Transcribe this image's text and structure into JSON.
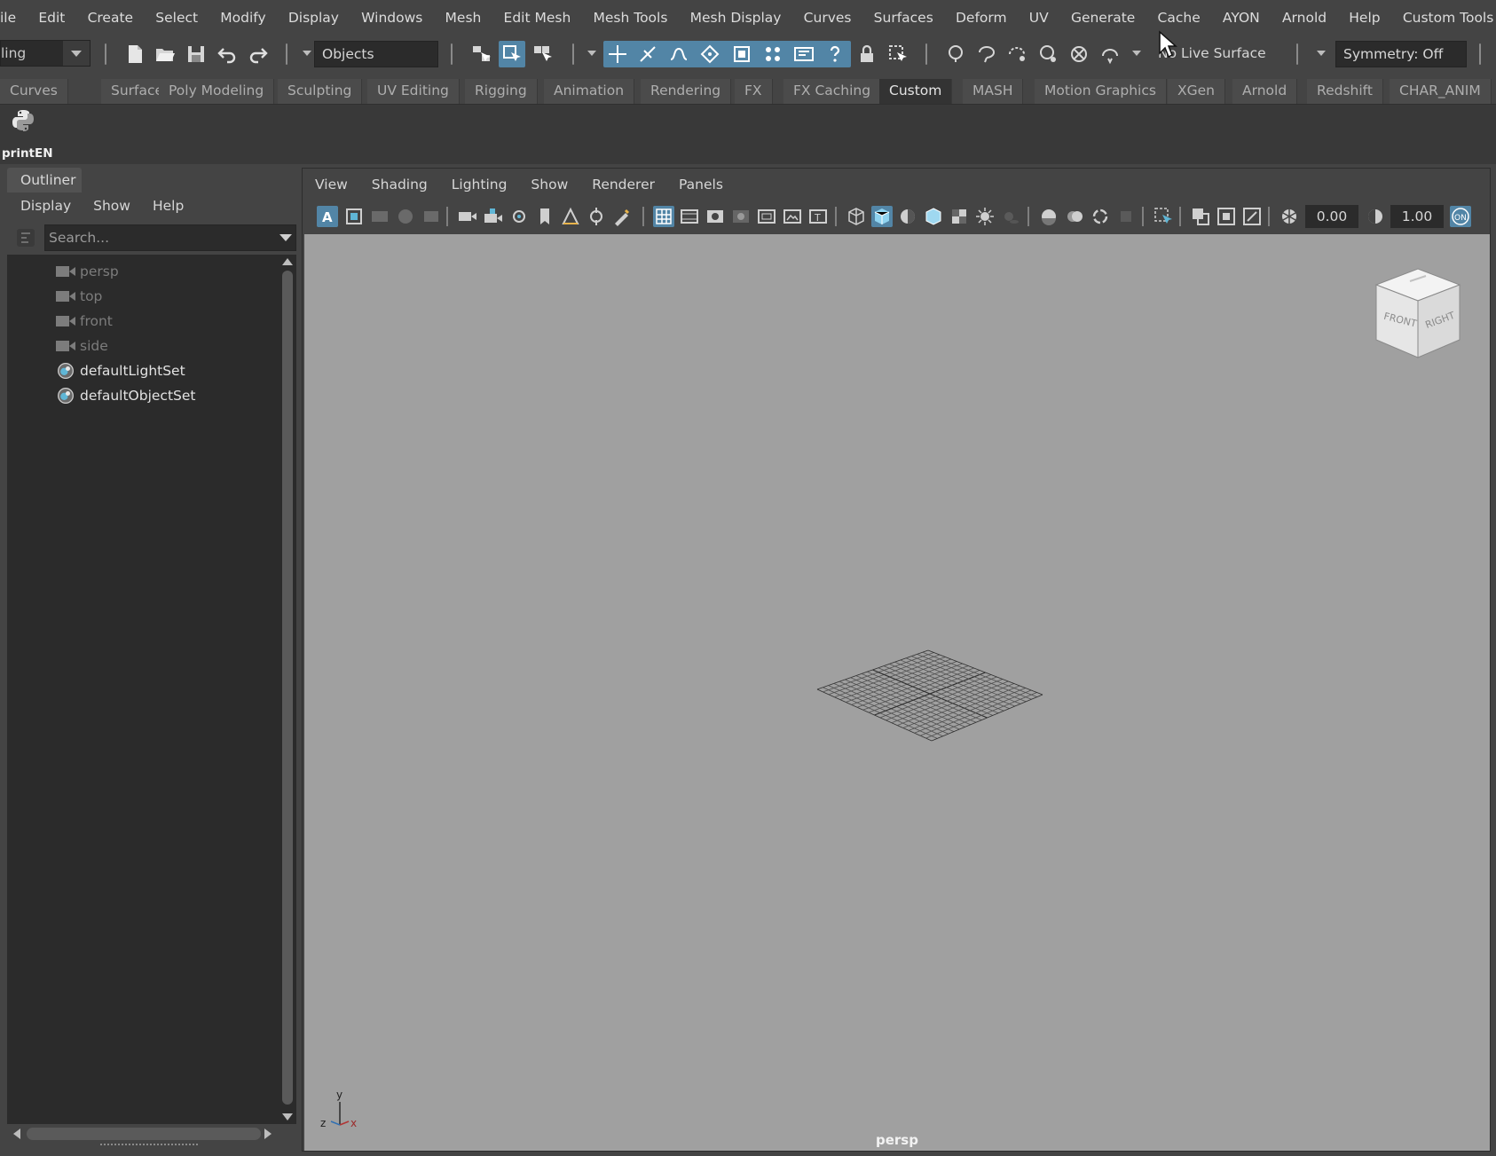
{
  "menubar": {
    "items": [
      "ile",
      "Edit",
      "Create",
      "Select",
      "Modify",
      "Display",
      "Windows",
      "Mesh",
      "Edit Mesh",
      "Mesh Tools",
      "Mesh Display",
      "Curves",
      "Surfaces",
      "Deform",
      "UV",
      "Generate",
      "Cache",
      "AYON",
      "Arnold",
      "Help",
      "Custom Tools"
    ]
  },
  "statusline": {
    "mode_value": "ling",
    "selection_mask_value": "Objects",
    "live_surface_value": "No Live Surface",
    "symmetry_value": "Symmetry: Off",
    "icons": [
      "new-scene-icon",
      "open-scene-icon",
      "save-scene-icon",
      "undo-icon",
      "redo-icon",
      "select-by-hierarchy-icon",
      "select-by-object-icon",
      "select-by-component-icon",
      "snap-grid-icon",
      "snap-curve-icon",
      "snap-point-icon",
      "snap-view-plane-icon",
      "render-icon",
      "ipr-icon",
      "render-settings-icon",
      "hypershade-icon",
      "lock-icon",
      "select-highlight-icon",
      "xray-icon",
      "lasso-icon"
    ]
  },
  "shelf": {
    "tabs": [
      "Curves",
      "Surfaces",
      "Poly Modeling",
      "Sculpting",
      "UV Editing",
      "Rigging",
      "Animation",
      "Rendering",
      "FX",
      "FX Caching",
      "Custom",
      "MASH",
      "Motion Graphics",
      "XGen",
      "Arnold",
      "Redshift",
      "CHAR_ANIM"
    ],
    "active_tab": "Custom",
    "items": [
      {
        "label": "printEN",
        "icon": "python-icon"
      }
    ]
  },
  "outliner": {
    "tab_label": "Outliner",
    "menu": [
      "Display",
      "Show",
      "Help"
    ],
    "search_placeholder": "Search...",
    "items": [
      {
        "label": "persp",
        "icon": "camera-icon",
        "dim": true
      },
      {
        "label": "top",
        "icon": "camera-icon",
        "dim": true
      },
      {
        "label": "front",
        "icon": "camera-icon",
        "dim": true
      },
      {
        "label": "side",
        "icon": "camera-icon",
        "dim": true
      },
      {
        "label": "defaultLightSet",
        "icon": "set-icon",
        "dim": false
      },
      {
        "label": "defaultObjectSet",
        "icon": "set-icon",
        "dim": false
      }
    ]
  },
  "viewport": {
    "menu": [
      "View",
      "Shading",
      "Lighting",
      "Show",
      "Renderer",
      "Panels"
    ],
    "exposure_value": "0.00",
    "gamma_value": "1.00",
    "camera_label": "persp",
    "viewcube_front": "FRONT",
    "viewcube_right": "RIGHT",
    "axis_labels": {
      "y": "y",
      "z": "z",
      "x": "x"
    },
    "background_color": "#a0a0a0",
    "accent_color": "#5285a6"
  }
}
